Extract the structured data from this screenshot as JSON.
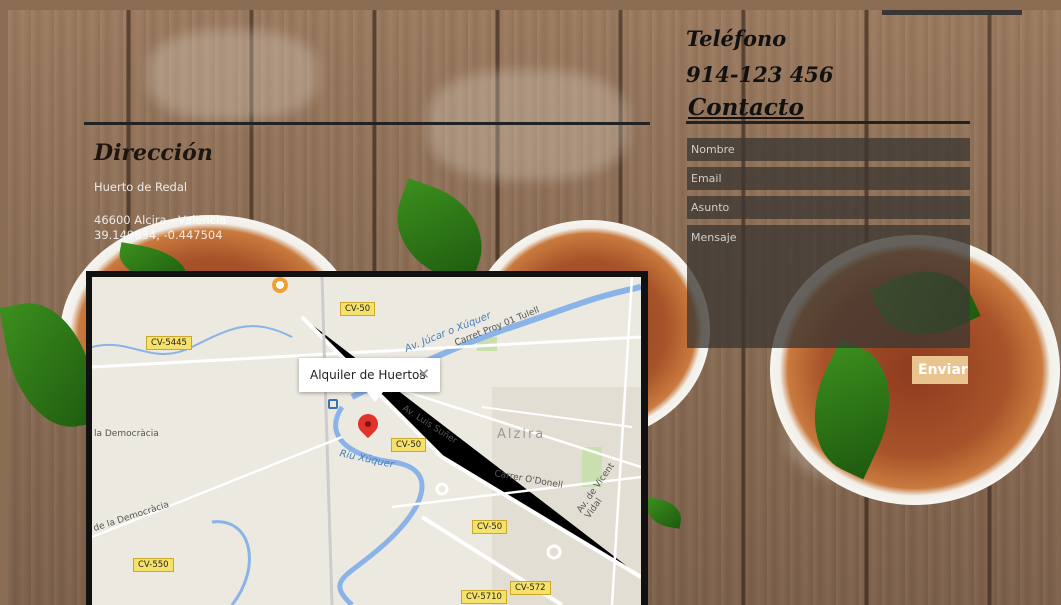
{
  "phone": {
    "title": "Teléfono",
    "number": "914-123 456"
  },
  "contact": {
    "title": "Contacto",
    "name_placeholder": "Nombre",
    "email_placeholder": "Email",
    "subject_placeholder": "Asunto",
    "message_placeholder": "Mensaje",
    "send_label": "Enviar"
  },
  "address": {
    "title": "Dirección",
    "lines": [
      "Huerto de Redal",
      "46600 Alcira - Valencia",
      "39.149834, -0.447504"
    ]
  },
  "map": {
    "popup_text": "Alquiler de Huertos",
    "popup_close": "✕",
    "city_label": "Alzira",
    "road_badges": [
      "CV-50",
      "CV-5445",
      "CV-50",
      "CV-50",
      "CV-550",
      "CV-572",
      "CV-5710"
    ],
    "street_labels": [
      "Av. Luis Suñer",
      "Carrer O'Donell",
      "Av. de Vicent Vidal",
      "Carret Proy 01 Tulell",
      "Av. Júcar o Xúquer",
      "la Democràcia",
      "de la Democràcia"
    ],
    "river_label": "Riu Xúquer"
  },
  "colors": {
    "accent_button": "#e9c48f",
    "form_field_bg": "#3c3732",
    "map_pin": "#e0332b"
  }
}
